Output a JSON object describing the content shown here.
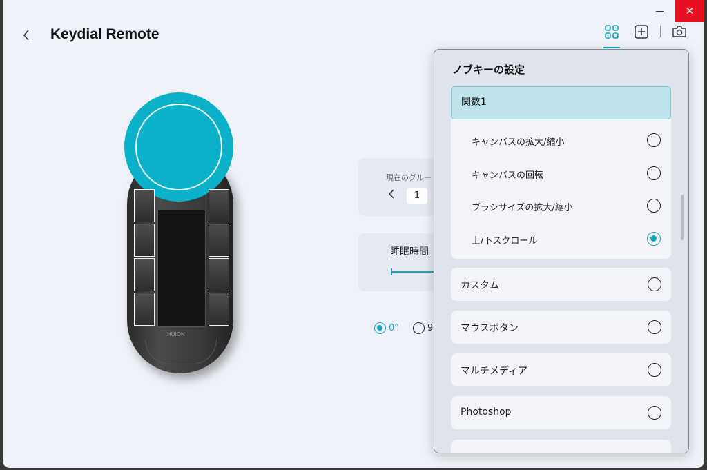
{
  "window": {
    "title": "Keydial Remote",
    "minimize_glyph": "—",
    "close_glyph": "✕"
  },
  "toolbar": {
    "icons": [
      "grid-view-icon",
      "add-icon",
      "camera-settings-icon"
    ]
  },
  "device": {
    "brand": "HUION"
  },
  "group": {
    "label": "現在のグルー",
    "number": "1"
  },
  "sleep": {
    "label": "睡眠時間"
  },
  "rotation": {
    "options": [
      "0°",
      "9"
    ],
    "selected": "0°"
  },
  "popup": {
    "title": "ノブキーの設定",
    "section": "関数1",
    "sub_items": [
      {
        "label": "キャンバスの拡大/縮小",
        "selected": false
      },
      {
        "label": "キャンバスの回転",
        "selected": false
      },
      {
        "label": "ブラシサイズの拡大/縮小",
        "selected": false
      },
      {
        "label": "上/下スクロール",
        "selected": true
      }
    ],
    "categories": [
      {
        "label": "カスタム",
        "selected": false
      },
      {
        "label": "マウスボタン",
        "selected": false
      },
      {
        "label": "マルチメディア",
        "selected": false
      },
      {
        "label": "Photoshop",
        "selected": false
      }
    ]
  },
  "colors": {
    "accent": "#14a7c3",
    "dial": "#0bb0c9",
    "close": "#e81123"
  }
}
